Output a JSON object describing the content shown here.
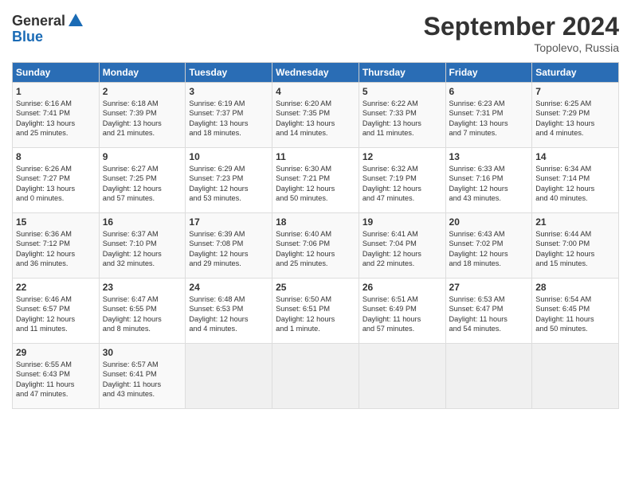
{
  "header": {
    "logo_general": "General",
    "logo_blue": "Blue",
    "title": "September 2024",
    "location": "Topolevo, Russia"
  },
  "days_of_week": [
    "Sunday",
    "Monday",
    "Tuesday",
    "Wednesday",
    "Thursday",
    "Friday",
    "Saturday"
  ],
  "weeks": [
    [
      {
        "day": "1",
        "lines": [
          "Sunrise: 6:16 AM",
          "Sunset: 7:41 PM",
          "Daylight: 13 hours",
          "and 25 minutes."
        ]
      },
      {
        "day": "2",
        "lines": [
          "Sunrise: 6:18 AM",
          "Sunset: 7:39 PM",
          "Daylight: 13 hours",
          "and 21 minutes."
        ]
      },
      {
        "day": "3",
        "lines": [
          "Sunrise: 6:19 AM",
          "Sunset: 7:37 PM",
          "Daylight: 13 hours",
          "and 18 minutes."
        ]
      },
      {
        "day": "4",
        "lines": [
          "Sunrise: 6:20 AM",
          "Sunset: 7:35 PM",
          "Daylight: 13 hours",
          "and 14 minutes."
        ]
      },
      {
        "day": "5",
        "lines": [
          "Sunrise: 6:22 AM",
          "Sunset: 7:33 PM",
          "Daylight: 13 hours",
          "and 11 minutes."
        ]
      },
      {
        "day": "6",
        "lines": [
          "Sunrise: 6:23 AM",
          "Sunset: 7:31 PM",
          "Daylight: 13 hours",
          "and 7 minutes."
        ]
      },
      {
        "day": "7",
        "lines": [
          "Sunrise: 6:25 AM",
          "Sunset: 7:29 PM",
          "Daylight: 13 hours",
          "and 4 minutes."
        ]
      }
    ],
    [
      {
        "day": "8",
        "lines": [
          "Sunrise: 6:26 AM",
          "Sunset: 7:27 PM",
          "Daylight: 13 hours",
          "and 0 minutes."
        ]
      },
      {
        "day": "9",
        "lines": [
          "Sunrise: 6:27 AM",
          "Sunset: 7:25 PM",
          "Daylight: 12 hours",
          "and 57 minutes."
        ]
      },
      {
        "day": "10",
        "lines": [
          "Sunrise: 6:29 AM",
          "Sunset: 7:23 PM",
          "Daylight: 12 hours",
          "and 53 minutes."
        ]
      },
      {
        "day": "11",
        "lines": [
          "Sunrise: 6:30 AM",
          "Sunset: 7:21 PM",
          "Daylight: 12 hours",
          "and 50 minutes."
        ]
      },
      {
        "day": "12",
        "lines": [
          "Sunrise: 6:32 AM",
          "Sunset: 7:19 PM",
          "Daylight: 12 hours",
          "and 47 minutes."
        ]
      },
      {
        "day": "13",
        "lines": [
          "Sunrise: 6:33 AM",
          "Sunset: 7:16 PM",
          "Daylight: 12 hours",
          "and 43 minutes."
        ]
      },
      {
        "day": "14",
        "lines": [
          "Sunrise: 6:34 AM",
          "Sunset: 7:14 PM",
          "Daylight: 12 hours",
          "and 40 minutes."
        ]
      }
    ],
    [
      {
        "day": "15",
        "lines": [
          "Sunrise: 6:36 AM",
          "Sunset: 7:12 PM",
          "Daylight: 12 hours",
          "and 36 minutes."
        ]
      },
      {
        "day": "16",
        "lines": [
          "Sunrise: 6:37 AM",
          "Sunset: 7:10 PM",
          "Daylight: 12 hours",
          "and 32 minutes."
        ]
      },
      {
        "day": "17",
        "lines": [
          "Sunrise: 6:39 AM",
          "Sunset: 7:08 PM",
          "Daylight: 12 hours",
          "and 29 minutes."
        ]
      },
      {
        "day": "18",
        "lines": [
          "Sunrise: 6:40 AM",
          "Sunset: 7:06 PM",
          "Daylight: 12 hours",
          "and 25 minutes."
        ]
      },
      {
        "day": "19",
        "lines": [
          "Sunrise: 6:41 AM",
          "Sunset: 7:04 PM",
          "Daylight: 12 hours",
          "and 22 minutes."
        ]
      },
      {
        "day": "20",
        "lines": [
          "Sunrise: 6:43 AM",
          "Sunset: 7:02 PM",
          "Daylight: 12 hours",
          "and 18 minutes."
        ]
      },
      {
        "day": "21",
        "lines": [
          "Sunrise: 6:44 AM",
          "Sunset: 7:00 PM",
          "Daylight: 12 hours",
          "and 15 minutes."
        ]
      }
    ],
    [
      {
        "day": "22",
        "lines": [
          "Sunrise: 6:46 AM",
          "Sunset: 6:57 PM",
          "Daylight: 12 hours",
          "and 11 minutes."
        ]
      },
      {
        "day": "23",
        "lines": [
          "Sunrise: 6:47 AM",
          "Sunset: 6:55 PM",
          "Daylight: 12 hours",
          "and 8 minutes."
        ]
      },
      {
        "day": "24",
        "lines": [
          "Sunrise: 6:48 AM",
          "Sunset: 6:53 PM",
          "Daylight: 12 hours",
          "and 4 minutes."
        ]
      },
      {
        "day": "25",
        "lines": [
          "Sunrise: 6:50 AM",
          "Sunset: 6:51 PM",
          "Daylight: 12 hours",
          "and 1 minute."
        ]
      },
      {
        "day": "26",
        "lines": [
          "Sunrise: 6:51 AM",
          "Sunset: 6:49 PM",
          "Daylight: 11 hours",
          "and 57 minutes."
        ]
      },
      {
        "day": "27",
        "lines": [
          "Sunrise: 6:53 AM",
          "Sunset: 6:47 PM",
          "Daylight: 11 hours",
          "and 54 minutes."
        ]
      },
      {
        "day": "28",
        "lines": [
          "Sunrise: 6:54 AM",
          "Sunset: 6:45 PM",
          "Daylight: 11 hours",
          "and 50 minutes."
        ]
      }
    ],
    [
      {
        "day": "29",
        "lines": [
          "Sunrise: 6:55 AM",
          "Sunset: 6:43 PM",
          "Daylight: 11 hours",
          "and 47 minutes."
        ]
      },
      {
        "day": "30",
        "lines": [
          "Sunrise: 6:57 AM",
          "Sunset: 6:41 PM",
          "Daylight: 11 hours",
          "and 43 minutes."
        ]
      },
      null,
      null,
      null,
      null,
      null
    ]
  ]
}
